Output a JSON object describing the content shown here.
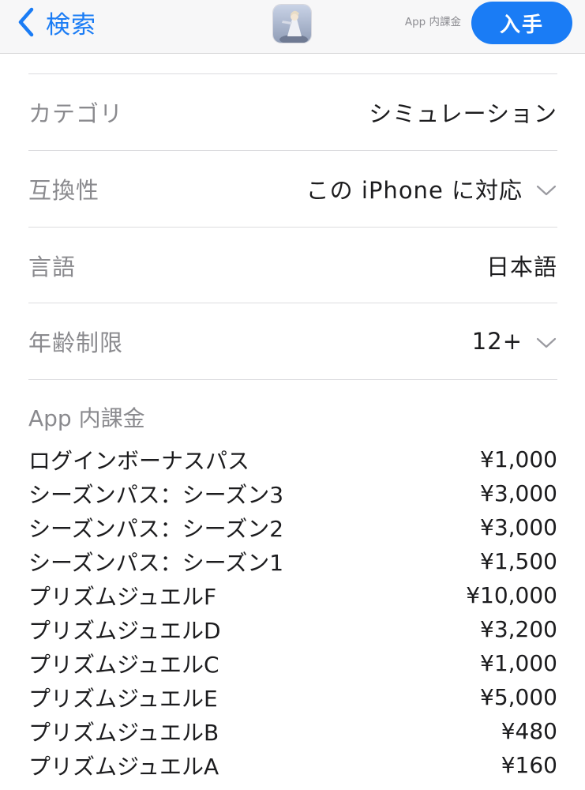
{
  "header": {
    "back_label": "検索",
    "back_icon": "chevron-left-icon",
    "app_icon": "app-icon",
    "iap_note": "App 内課金",
    "get_label": "入手",
    "accent_color": "#1a7cf5"
  },
  "info": {
    "rows": [
      {
        "label": "カテゴリ",
        "value": "シミュレーション",
        "expandable": false
      },
      {
        "label": "互換性",
        "value": "この iPhone に対応",
        "expandable": true
      },
      {
        "label": "言語",
        "value": "日本語",
        "expandable": false
      },
      {
        "label": "年齢制限",
        "value": "12+",
        "expandable": true
      }
    ]
  },
  "iap": {
    "heading": "App 内課金",
    "items": [
      {
        "name": "ログインボーナスパス",
        "price": "¥1,000"
      },
      {
        "name": "シーズンパス：シーズン3",
        "price": "¥3,000"
      },
      {
        "name": "シーズンパス：シーズン2",
        "price": "¥3,000"
      },
      {
        "name": "シーズンパス：シーズン1",
        "price": "¥1,500"
      },
      {
        "name": "プリズムジュエルF",
        "price": "¥10,000"
      },
      {
        "name": "プリズムジュエルD",
        "price": "¥3,200"
      },
      {
        "name": "プリズムジュエルC",
        "price": "¥1,000"
      },
      {
        "name": "プリズムジュエルE",
        "price": "¥5,000"
      },
      {
        "name": "プリズムジュエルB",
        "price": "¥480"
      },
      {
        "name": "プリズムジュエルA",
        "price": "¥160"
      }
    ]
  }
}
